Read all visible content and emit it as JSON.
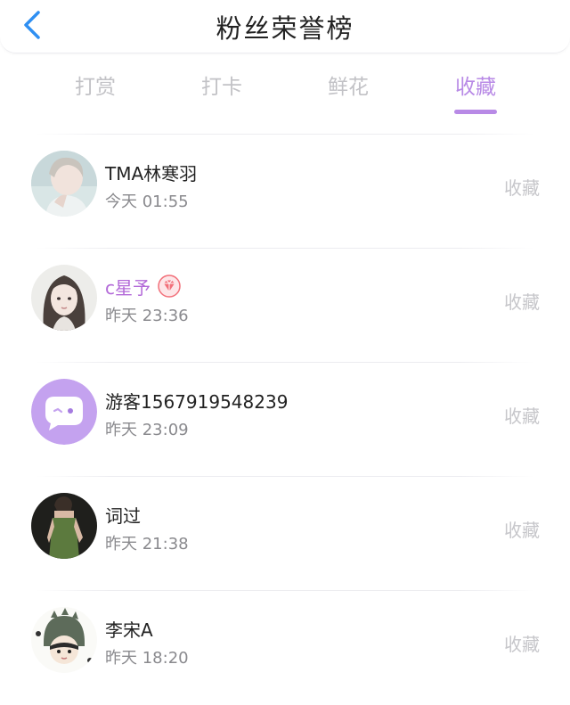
{
  "header": {
    "title": "粉丝荣誉榜",
    "back_icon": "chevron-left-icon"
  },
  "tabs": [
    {
      "label": "打赏",
      "active": false
    },
    {
      "label": "打卡",
      "active": false
    },
    {
      "label": "鲜花",
      "active": false
    },
    {
      "label": "收藏",
      "active": true
    }
  ],
  "colors": {
    "accent": "#b88ae6",
    "vip_name": "#b36ad8",
    "back_arrow": "#2f8ff2",
    "muted": "#c6c6ca",
    "badge": "#f2707a"
  },
  "list": [
    {
      "name": "TMA林寒羽",
      "time": "今天 01:55",
      "action": "收藏",
      "vip": false,
      "avatar": "avatar-boy"
    },
    {
      "name": "c星予",
      "time": "昨天 23:36",
      "action": "收藏",
      "vip": true,
      "badge_icon": "diamond-badge-icon",
      "avatar": "avatar-girl"
    },
    {
      "name": "游客1567919548239",
      "time": "昨天 23:09",
      "action": "收藏",
      "vip": false,
      "avatar": "avatar-guest-chat-bubble"
    },
    {
      "name": "词过",
      "time": "昨天 21:38",
      "action": "收藏",
      "vip": false,
      "avatar": "avatar-green-dress"
    },
    {
      "name": "李宋A",
      "time": "昨天 18:20",
      "action": "收藏",
      "vip": false,
      "avatar": "avatar-dino-cartoon"
    }
  ]
}
